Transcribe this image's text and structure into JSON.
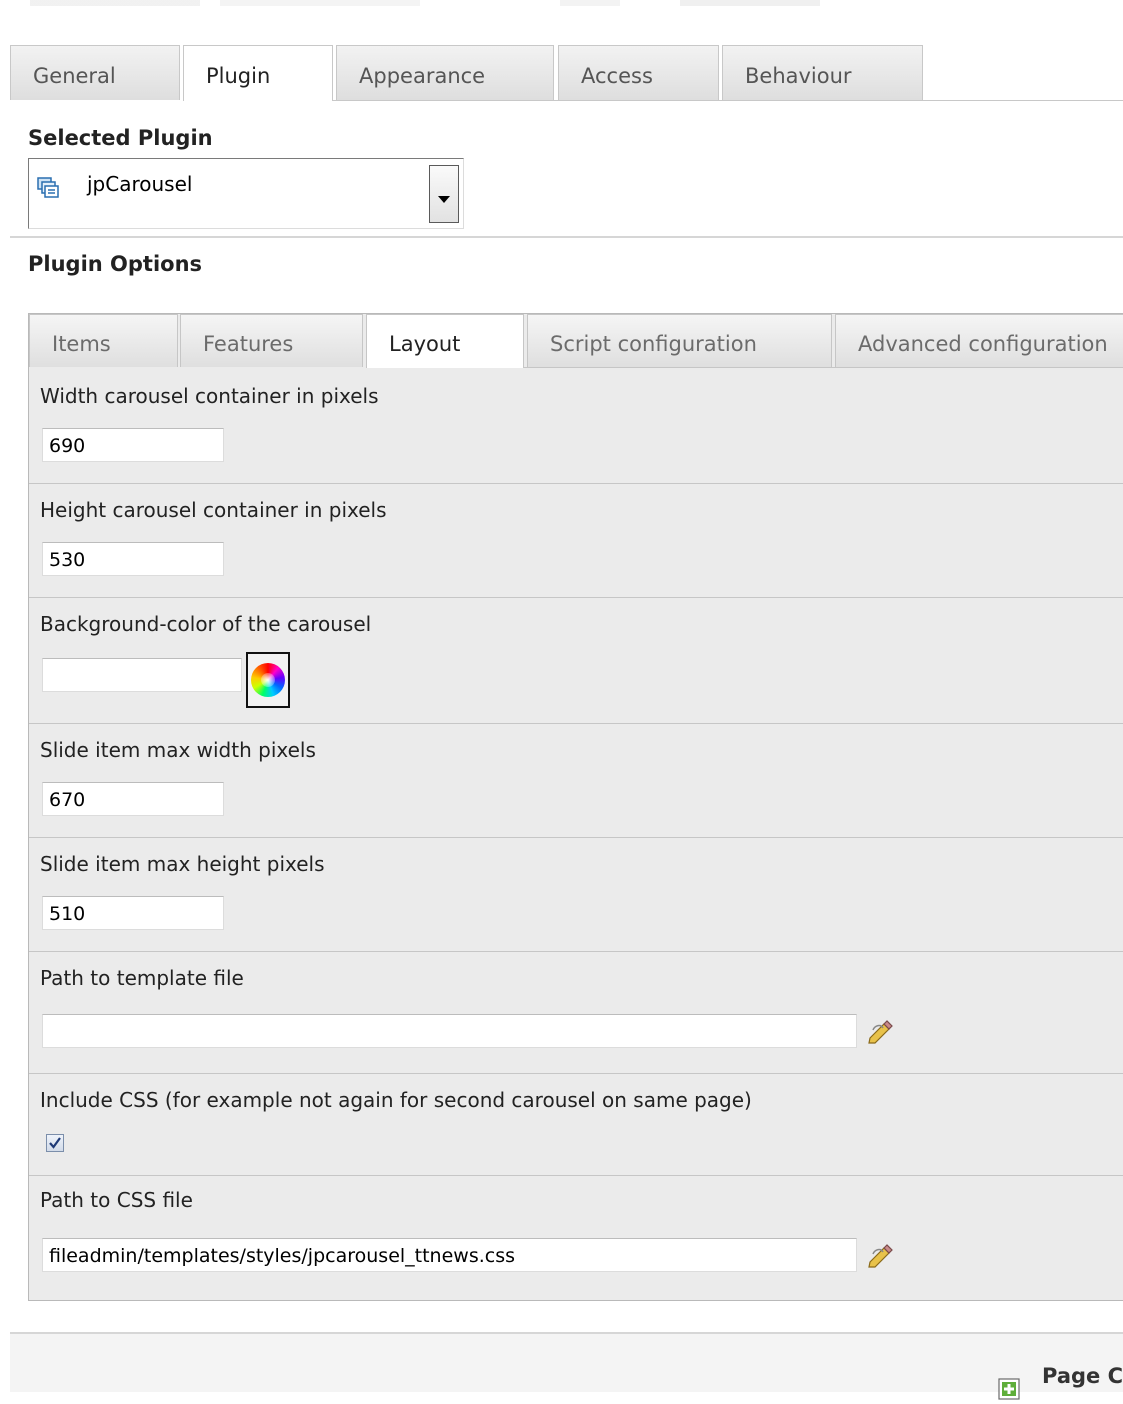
{
  "main_tabs": [
    {
      "label": "General",
      "active": false
    },
    {
      "label": "Plugin",
      "active": true
    },
    {
      "label": "Appearance",
      "active": false
    },
    {
      "label": "Access",
      "active": false
    },
    {
      "label": "Behaviour",
      "active": false
    }
  ],
  "selected_plugin": {
    "label": "Selected Plugin",
    "value": "jpCarousel",
    "icon": "plugin-icon"
  },
  "plugin_options": {
    "label": "Plugin Options",
    "tabs": [
      {
        "label": "Items",
        "active": false
      },
      {
        "label": "Features",
        "active": false
      },
      {
        "label": "Layout",
        "active": true
      },
      {
        "label": "Script configuration",
        "active": false
      },
      {
        "label": "Advanced configuration",
        "active": false
      }
    ],
    "fields": {
      "width": {
        "label": "Width carousel container in pixels",
        "value": "690"
      },
      "height": {
        "label": "Height carousel container in pixels",
        "value": "530"
      },
      "bgcolor": {
        "label": "Background-color of the carousel",
        "value": ""
      },
      "max_width": {
        "label": "Slide item max width pixels",
        "value": "670"
      },
      "max_height": {
        "label": "Slide item max height pixels",
        "value": "510"
      },
      "template": {
        "label": "Path to template file",
        "value": ""
      },
      "include_css": {
        "label": "Include CSS (for example not again for second carousel on same page)",
        "checked": true
      },
      "css_path": {
        "label": "Path to CSS file",
        "value": "fileadmin/templates/styles/jpcarousel_ttnews.css"
      }
    }
  },
  "footer": {
    "label": "Page C",
    "icon": "add-page-icon"
  },
  "colors": {
    "panel_bg": "#ebebeb",
    "tab_border": "#c6c6c6",
    "footer_bg": "#f4f4f4"
  }
}
